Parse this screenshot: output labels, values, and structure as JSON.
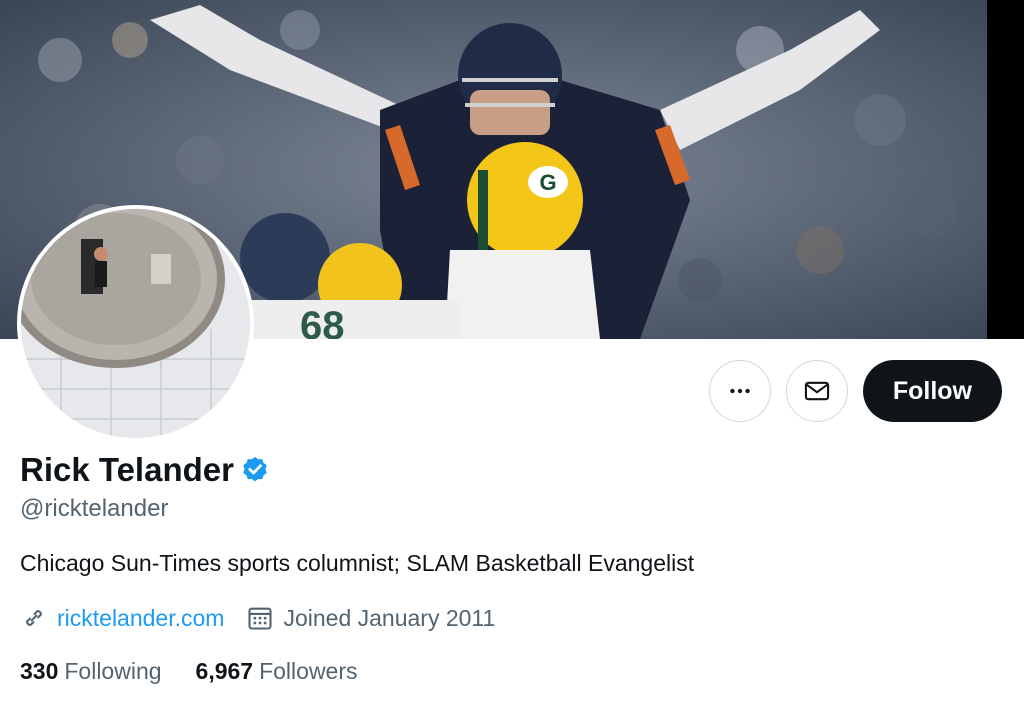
{
  "profile": {
    "name": "Rick Telander",
    "handle": "@ricktelander",
    "bio": "Chicago Sun-Times sports columnist; SLAM Basketball Evangelist",
    "verified": true,
    "website": "ricktelander.com",
    "joined": "Joined January 2011"
  },
  "stats": {
    "following_count": "330",
    "following_label": "Following",
    "followers_count": "6,967",
    "followers_label": "Followers"
  },
  "actions": {
    "more_icon": "more-horizontal-icon",
    "message_icon": "envelope-icon",
    "follow_label": "Follow"
  },
  "colors": {
    "accent": "#1d9bf0",
    "primary_text": "#0f1419",
    "secondary_text": "#536471",
    "button_dark": "#0f1419",
    "border": "#cfd9de"
  }
}
